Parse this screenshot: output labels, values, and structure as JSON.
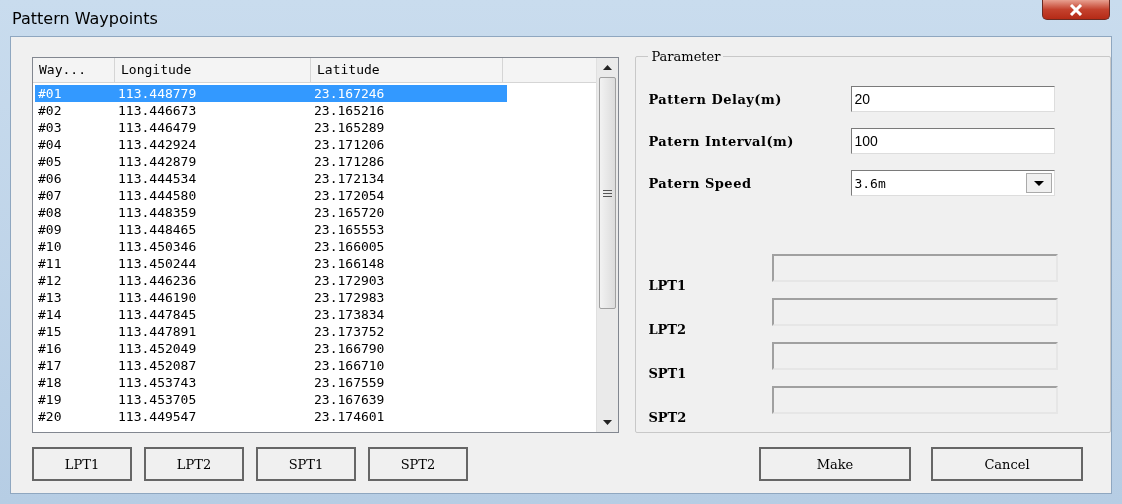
{
  "window": {
    "title": "Pattern Waypoints"
  },
  "table": {
    "columns": [
      "Way...",
      "Longitude",
      "Latitude"
    ],
    "rows": [
      {
        "cells": [
          "#01",
          "113.448779",
          "23.167246"
        ],
        "selected": true
      },
      {
        "cells": [
          "#02",
          "113.446673",
          "23.165216"
        ],
        "selected": false
      },
      {
        "cells": [
          "#03",
          "113.446479",
          "23.165289"
        ],
        "selected": false
      },
      {
        "cells": [
          "#04",
          "113.442924",
          "23.171206"
        ],
        "selected": false
      },
      {
        "cells": [
          "#05",
          "113.442879",
          "23.171286"
        ],
        "selected": false
      },
      {
        "cells": [
          "#06",
          "113.444534",
          "23.172134"
        ],
        "selected": false
      },
      {
        "cells": [
          "#07",
          "113.444580",
          "23.172054"
        ],
        "selected": false
      },
      {
        "cells": [
          "#08",
          "113.448359",
          "23.165720"
        ],
        "selected": false
      },
      {
        "cells": [
          "#09",
          "113.448465",
          "23.165553"
        ],
        "selected": false
      },
      {
        "cells": [
          "#10",
          "113.450346",
          "23.166005"
        ],
        "selected": false
      },
      {
        "cells": [
          "#11",
          "113.450244",
          "23.166148"
        ],
        "selected": false
      },
      {
        "cells": [
          "#12",
          "113.446236",
          "23.172903"
        ],
        "selected": false
      },
      {
        "cells": [
          "#13",
          "113.446190",
          "23.172983"
        ],
        "selected": false
      },
      {
        "cells": [
          "#14",
          "113.447845",
          "23.173834"
        ],
        "selected": false
      },
      {
        "cells": [
          "#15",
          "113.447891",
          "23.173752"
        ],
        "selected": false
      },
      {
        "cells": [
          "#16",
          "113.452049",
          "23.166790"
        ],
        "selected": false
      },
      {
        "cells": [
          "#17",
          "113.452087",
          "23.166710"
        ],
        "selected": false
      },
      {
        "cells": [
          "#18",
          "113.453743",
          "23.167559"
        ],
        "selected": false
      },
      {
        "cells": [
          "#19",
          "113.453705",
          "23.167639"
        ],
        "selected": false
      },
      {
        "cells": [
          "#20",
          "113.449547",
          "23.174601"
        ],
        "selected": false
      }
    ]
  },
  "parameter": {
    "title": "Parameter",
    "fields": [
      {
        "kind": "text",
        "label": "Pattern Delay(m)",
        "value": "20"
      },
      {
        "kind": "text",
        "label": "Patern Interval(m)",
        "value": "100"
      },
      {
        "kind": "dropdown",
        "label": "Patern Speed",
        "value": "3.6m"
      }
    ],
    "points": [
      {
        "label": "LPT1",
        "disabled": true
      },
      {
        "label": "LPT2",
        "disabled": true
      },
      {
        "label": "SPT1",
        "disabled": true
      },
      {
        "label": "SPT2",
        "disabled": true
      }
    ]
  },
  "point_buttons": [
    "LPT1",
    "LPT2",
    "SPT1",
    "SPT2"
  ],
  "action_buttons": [
    "Make",
    "Cancel"
  ]
}
